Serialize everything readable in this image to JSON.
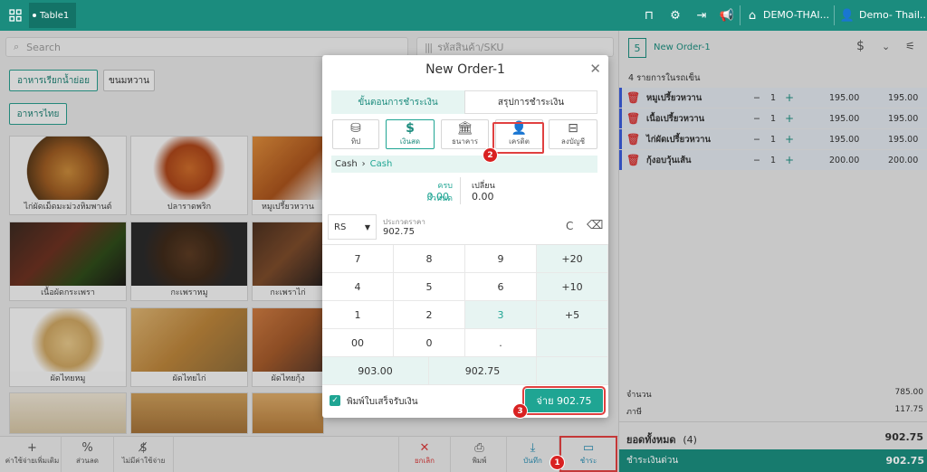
{
  "topbar": {
    "tab_label": "Table1",
    "branch": "DEMO-THAI...",
    "user": "Demo- Thail..."
  },
  "left": {
    "search_placeholder": "Search",
    "sku_placeholder": "รหัสสินค้า/SKU",
    "categories": [
      "อาหารเรียกน้ำย่อย",
      "ขนมหวาน",
      "อาหารไทย"
    ],
    "foods": [
      "ไก่ผัดเม็ดมะม่วงหิมพานต์",
      "ปลาราดพริก",
      "หมูเปรี้ยวหวาน",
      "เนื้อผัดกระเพรา",
      "กะเพราหมู",
      "กะเพราไก่",
      "ผัดไทยหมู",
      "ผัดไทยไก่",
      "ผัดไทยกุ้ง"
    ],
    "bottom": {
      "extra": "ค่าใช้จ่ายเพิ่มเติม",
      "discount": "ส่วนลด",
      "no_charge": "ไม่มีค่าใช้จ่าย",
      "cancel": "ยกเลิก",
      "print": "พิมพ์",
      "save": "บันทึก",
      "pay": "ชำระ"
    }
  },
  "order": {
    "count": "5",
    "name": "New Order-1",
    "items_title": "4 รายการในรถเข็น",
    "items": [
      {
        "name": "หมูเปรี้ยวหวาน",
        "qty": "1",
        "price": "195.00",
        "total": "195.00"
      },
      {
        "name": "เนื้อเปรี้ยวหวาน",
        "qty": "1",
        "price": "195.00",
        "total": "195.00"
      },
      {
        "name": "ไก่ผัดเปรี้ยวหวาน",
        "qty": "1",
        "price": "195.00",
        "total": "195.00"
      },
      {
        "name": "กุ้งอบวุ้นเส้น",
        "qty": "1",
        "price": "200.00",
        "total": "200.00"
      }
    ],
    "amount_label": "จำนวน",
    "amount": "785.00",
    "tax_label": "ภาษี",
    "tax": "117.75",
    "grand_label": "ยอดทั้งหมด",
    "grand_count": "(4)",
    "grand": "902.75",
    "quick_pay_label": "ชำระเงินด่วน",
    "quick_pay": "902.75"
  },
  "modal": {
    "title": "New Order-1",
    "tab_steps": "ขั้นตอนการชำระเงิน",
    "tab_summary": "สรุปการชำระเงิน",
    "methods": [
      "ทิป",
      "เงินสด",
      "ธนาคาร",
      "เครดิต",
      "ลงบัญชี"
    ],
    "breadcrumb_root": "Cash",
    "breadcrumb_leaf": "Cash",
    "due_label": "ครบกำหนด",
    "due": "0.00",
    "change_label": "เปลี่ยน",
    "change": "0.00",
    "currency": "RS",
    "face_label": "ประกวดราคา",
    "face_value": "902.75",
    "clear": "C",
    "keys": [
      "7",
      "8",
      "9",
      "+20",
      "4",
      "5",
      "6",
      "+10",
      "1",
      "2",
      "3",
      "+5",
      "00",
      "0",
      "."
    ],
    "quick1": "903.00",
    "quick2": "902.75",
    "print_receipt": "พิมพ์ใบเสร็จรับเงิน",
    "pay_button": "จ่าย 902.75"
  },
  "annotations": [
    "1",
    "2",
    "3"
  ]
}
